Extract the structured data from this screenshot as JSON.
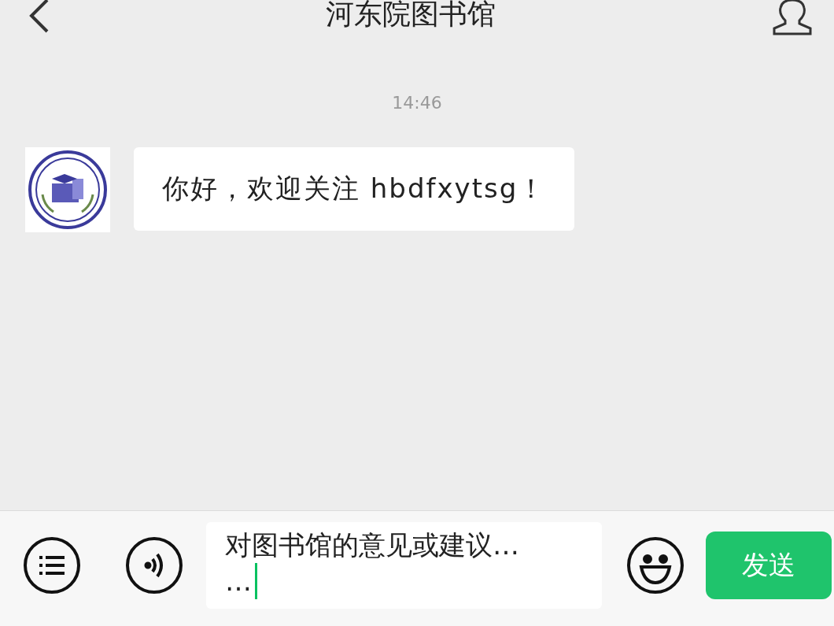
{
  "header": {
    "title": "河东院图书馆"
  },
  "messages": [
    {
      "kind": "timestamp",
      "text": "14:46"
    },
    {
      "kind": "incoming",
      "text": "你好，欢迎关注 hbdfxytsg！"
    }
  ],
  "composer": {
    "value": "对图书馆的意见或建议… …",
    "send_label": "发送"
  }
}
